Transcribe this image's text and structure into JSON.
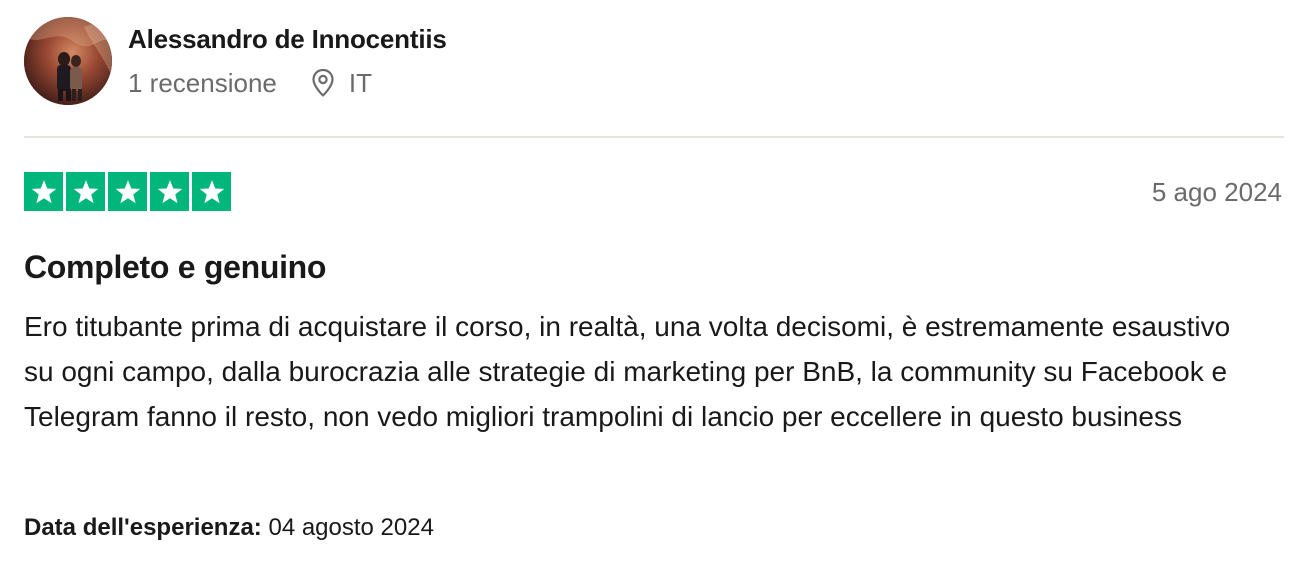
{
  "reviewer": {
    "name": "Alessandro de Innocentiis",
    "review_count": "1 recensione",
    "country": "IT"
  },
  "review": {
    "rating": 5,
    "max_rating": 5,
    "date": "5 ago 2024",
    "title": "Completo e genuino",
    "body": "Ero titubante prima di acquistare il corso, in realtà, una volta decisomi, è estremamente esaustivo su ogni campo, dalla burocrazia alle strategie di marketing per BnB, la community su Facebook e Telegram fanno il resto, non vedo migliori trampolini di lancio per eccellere in questo business",
    "experience_label": "Data dell'esperienza:",
    "experience_date": "04 agosto 2024"
  },
  "colors": {
    "star_green": "#00b67a",
    "text_primary": "#191919",
    "text_secondary": "#6b6b6b"
  },
  "icons": {
    "location": "map-pin-icon",
    "star": "star-icon"
  }
}
